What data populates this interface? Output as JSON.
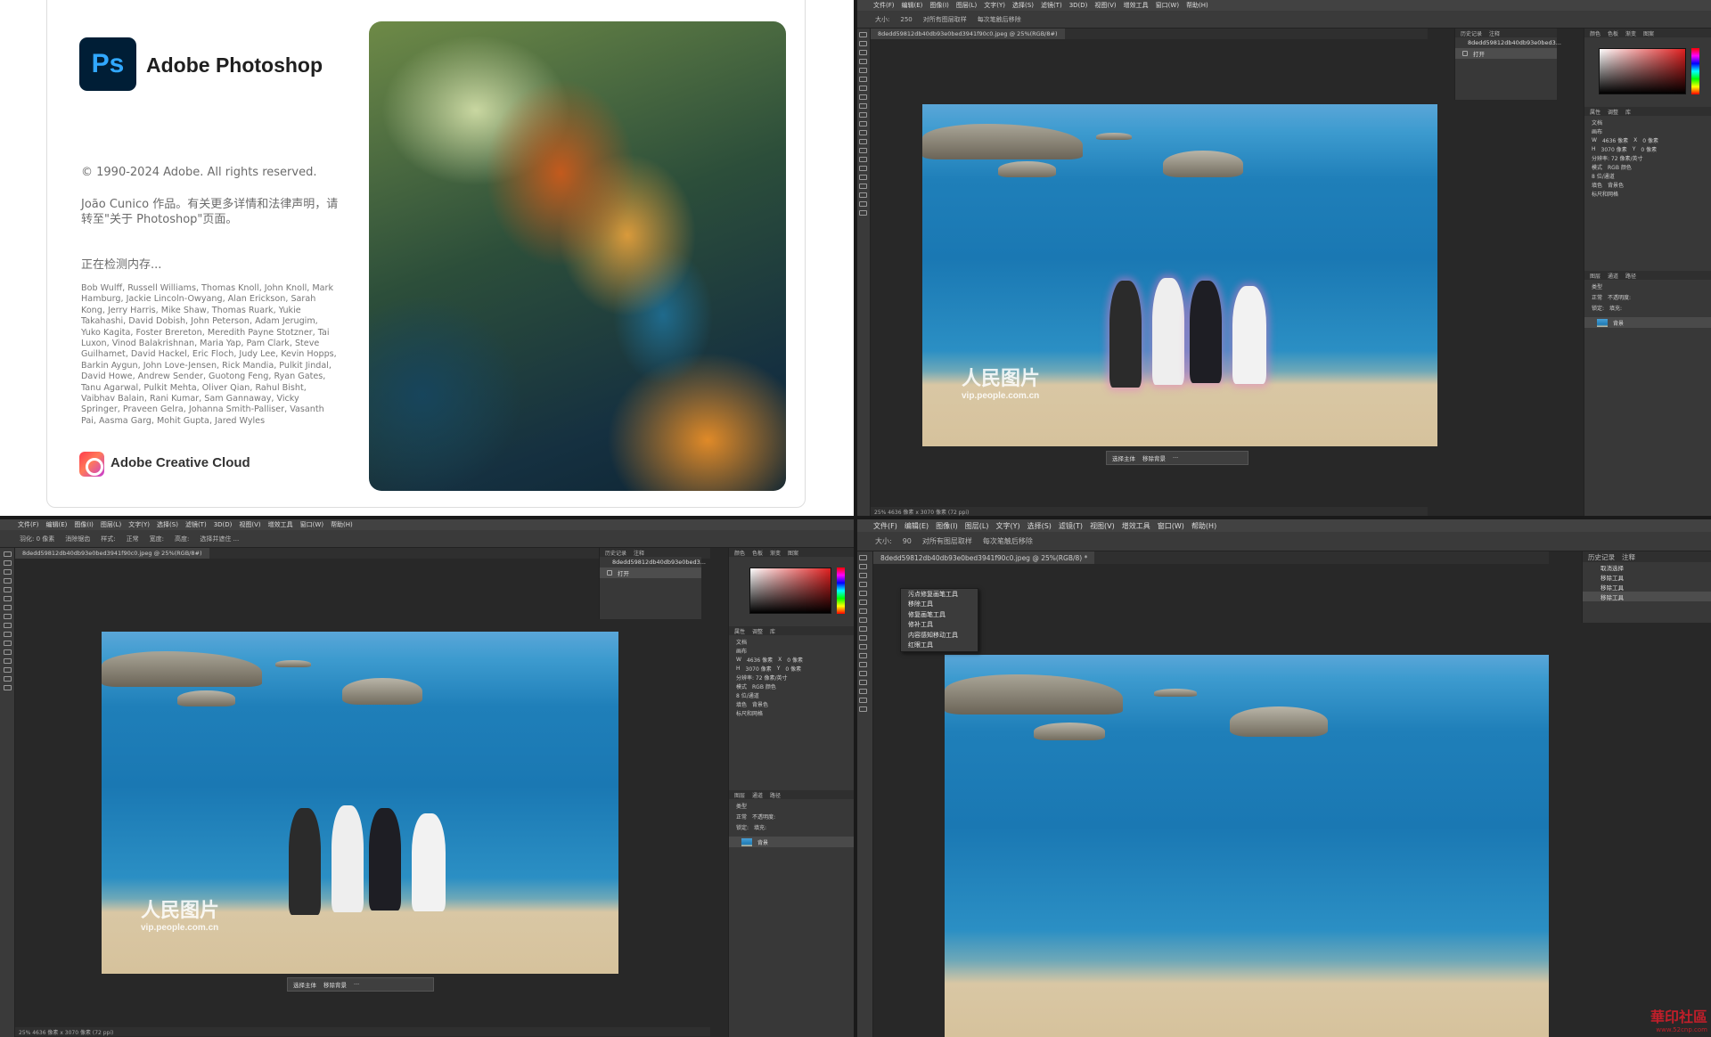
{
  "splash": {
    "logo_text": "Ps",
    "app_name": "Adobe Photoshop",
    "copyright": "© 1990-2024 Adobe. All rights reserved.",
    "credit": "João Cunico 作品。有关更多详情和法律声明，请转至\"关于 Photoshop\"页面。",
    "loading": "正在检测内存...",
    "names": "Bob Wulff, Russell Williams, Thomas Knoll, John Knoll, Mark Hamburg, Jackie Lincoln-Owyang, Alan Erickson, Sarah Kong, Jerry Harris, Mike Shaw, Thomas Ruark, Yukie Takahashi, David Dobish, John Peterson, Adam Jerugim, Yuko Kagita, Foster Brereton, Meredith Payne Stotzner, Tai Luxon, Vinod Balakrishnan, Maria Yap, Pam Clark, Steve Guilhamet, David Hackel, Eric Floch, Judy Lee, Kevin Hopps, Barkin Aygun, John Love-Jensen, Rick Mandia, Pulkit Jindal, David Howe, Andrew Sender, Guotong Feng, Ryan Gates, Tanu Agarwal, Pulkit Mehta, Oliver Qian, Rahul Bisht, Vaibhav Balain, Rani Kumar, Sam Gannaway, Vicky Springer, Praveen Gelra, Johanna Smith-Palliser, Vasanth Pai, Aasma Garg, Mohit Gupta, Jared Wyles",
    "cc_name": "Adobe Creative Cloud"
  },
  "menu": [
    "文件(F)",
    "编辑(E)",
    "图像(I)",
    "图层(L)",
    "文字(Y)",
    "选择(S)",
    "滤镜(T)",
    "3D(D)",
    "视图(V)",
    "增效工具",
    "窗口(W)",
    "帮助(H)"
  ],
  "menu_q4": [
    "文件(F)",
    "编辑(E)",
    "图像(I)",
    "图层(L)",
    "文字(Y)",
    "选择(S)",
    "滤镜(T)",
    "视图(V)",
    "增效工具",
    "窗口(W)",
    "帮助(H)"
  ],
  "options": {
    "size_label": "大小:",
    "size_value_q2": "250",
    "size_value_q4": "90",
    "sample_all": "对所有图层取样",
    "stroke_after": "每次笔触后移除",
    "feather_label": "羽化: 0 像素",
    "smooth": "消除锯齿",
    "style_label": "样式:",
    "style_value": "正常",
    "width_label": "宽度:",
    "height_label": "高度:",
    "select_mask": "选择并遮住 ..."
  },
  "doc_tab": "8dedd59812db40db93e0bed3941f90c0.jpeg @ 25%(RGB/8#)",
  "doc_tab_q4": "8dedd59812db40db93e0bed3941f90c0.jpeg @ 25%(RGB/8) *",
  "status_text": "25%   4636 像素 x 3070 像素 (72 ppi)",
  "watermark": {
    "big": "人民图片",
    "small": "vip.people.com.cn",
    "tag": "VIP"
  },
  "contextbar": {
    "select_subject": "选择主体",
    "remove_bg": "移除背景",
    "more": "···"
  },
  "history_panel": {
    "tabs": [
      "历史记录",
      "注释"
    ],
    "snapshot": "8dedd59812db40db93e0bed3...",
    "items_q2": [
      "打开"
    ],
    "items_q4": [
      "取消选择",
      "移除工具",
      "移除工具",
      "移除工具"
    ]
  },
  "color_panel": {
    "tabs": [
      "颜色",
      "色板",
      "渐变",
      "图案"
    ]
  },
  "properties": {
    "tabs": [
      "属性",
      "调整",
      "库"
    ],
    "doc": "文档",
    "canvas": "画布",
    "w_label": "W",
    "w_value": "4636 像素",
    "h_label": "H",
    "h_value": "3070 像素",
    "x_label": "X",
    "y_label": "Y",
    "x_value": "0 像素",
    "y_value": "0 像素",
    "resolution": "分辨率: 72 像素/英寸",
    "mode_label": "模式",
    "mode_value": "RGB 颜色",
    "depth_value": "8 位/通道",
    "fill_label": "填色",
    "fill_value": "背景色",
    "rulers": "标尺和网格"
  },
  "layers_panel": {
    "tabs": [
      "图层",
      "通道",
      "路径"
    ],
    "kind": "类型",
    "blend": "正常",
    "opacity": "不透明度:",
    "lock": "锁定:",
    "fill": "填充:",
    "layer_name": "背景"
  },
  "flyout": {
    "items": [
      "污点修复画笔工具",
      "移除工具",
      "修复画笔工具",
      "修补工具",
      "内容感知移动工具",
      "红眼工具"
    ],
    "shortcut": "J"
  },
  "site": {
    "name": "華印社區",
    "url": "www.52cnp.com"
  }
}
